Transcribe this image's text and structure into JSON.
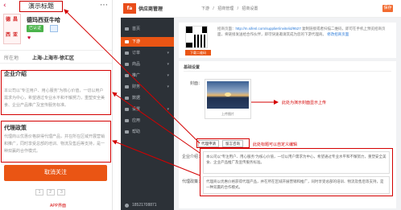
{
  "mobile": {
    "back_icon": "chevron-left-icon",
    "title_callout": "演示标题",
    "menu_icon": "ellipsis-icon",
    "brand": {
      "logo_chars": [
        "德",
        "昌",
        "西",
        "亚"
      ],
      "name": "德玛西亚牛哈",
      "badge": "已认证",
      "heart_icon": "heart-icon"
    },
    "location": {
      "label": "所在地",
      "value": "上海-上海市-徐汇区"
    },
    "intro": {
      "title": "企业介绍",
      "text": "本公司以“专注用户、用心服务”为核心价值，一切以用户需求为中心，希望通过专业水平和不懈努力，重塑安全美食、企业产品推广及宣传服务标准。"
    },
    "policy": {
      "title": "代理政策",
      "text": "代理商以优惠价格获得代理产品，并在所在区域开展营销和推广，同时享受总部的培训、物流及售后等支持，是一种双赢的合作模式。"
    },
    "follow_button": "取消关注",
    "pager": [
      "1",
      "2",
      "3"
    ],
    "app_caption": "APP界面"
  },
  "admin": {
    "logo_text": "fa",
    "system_name": "供应商管理",
    "breadcrumb": [
      "下游",
      "/",
      "招商管理",
      "/",
      "招商设置"
    ],
    "save_button": "保存",
    "sidebar": [
      {
        "label": "首页",
        "icon": "home-icon"
      },
      {
        "label": "下游",
        "icon": "users-icon",
        "active": true
      },
      {
        "label": "订单",
        "icon": "order-icon"
      },
      {
        "label": "商品",
        "icon": "goods-icon"
      },
      {
        "label": "推广",
        "icon": "megaphone-icon"
      },
      {
        "label": "财务",
        "icon": "wallet-icon"
      },
      {
        "label": "数据",
        "icon": "chart-icon"
      },
      {
        "label": "设置",
        "icon": "gear-icon"
      },
      {
        "label": "应用",
        "icon": "grid-icon"
      },
      {
        "label": "帮助",
        "icon": "help-icon"
      }
    ],
    "account": "18521708871",
    "qr": {
      "download_button": "下载二维码",
      "text_prefix": "招商页面：",
      "link": "http://m.sifenl.com/supplier/invite/id/9527",
      "text_body": "复制链接或者扫描二维码，即可在手机上预览招商页面，将链接发送给合作伙伴，即可快速邀请其成为您的下游代理商。",
      "edit_link": "修改招商页面"
    },
    "form": {
      "section_title": "基础设置",
      "cover_label": "封面：",
      "cover_caption": "上传图片",
      "cover_note": "此处为演示封面显示上传",
      "tags": [
        "代理申请",
        "留言咨询"
      ],
      "tags_note": "此处标题可以自定义编辑",
      "intro_label": "企业介绍：",
      "intro_text": "本公司以“专注用户、用心服务”为核心价值，一切以用户需求为中心，希望通过专业水平和不懈努力，重塑安全美食、企业产品推广及宣传服务标准。",
      "policy_label": "代理政策：",
      "policy_text": "代理商以优惠价格获得代理产品，并在所在区域开展营销和推广，同时享受总部的培训、物流及售后等支持，是一种双赢的合作模式。"
    }
  },
  "colors": {
    "accent": "#ea5514",
    "annotation": "#d40000",
    "sidebar": "#2c3137",
    "link": "#2a7ad9"
  }
}
